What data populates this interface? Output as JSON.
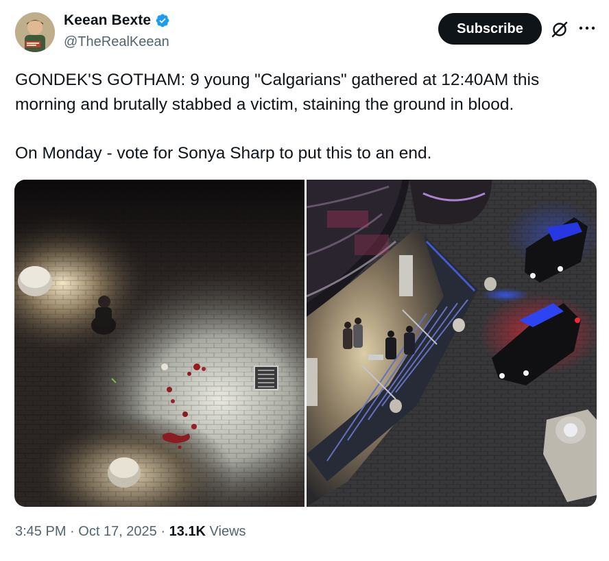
{
  "author": {
    "display_name": "Keean Bexte",
    "handle": "@TheRealKeean",
    "verified_icon": "verified-badge-icon",
    "verified_color": "#1d9bf0"
  },
  "actions": {
    "subscribe_label": "Subscribe",
    "grok_icon": "grok-icon",
    "more_icon": "more-icon"
  },
  "tweet": {
    "text_line_1": "GONDEK'S GOTHAM: 9 young \"Calgarians\" gathered at 12:40AM this morning and brutally stabbed a victim, staining the ground in blood.",
    "text_line_2": "On Monday - vote for Sonya Sharp to put this to an end."
  },
  "media": {
    "photos": [
      {
        "name": "photo-bloodstained-pavement"
      },
      {
        "name": "photo-police-scene"
      }
    ]
  },
  "meta": {
    "time": "3:45 PM",
    "separator": "·",
    "date": "Oct 17, 2025",
    "views_count": "13.1K",
    "views_label": "Views"
  },
  "colors": {
    "text_primary": "#0f1419",
    "text_secondary": "#536471",
    "button_bg": "#0f1419"
  }
}
